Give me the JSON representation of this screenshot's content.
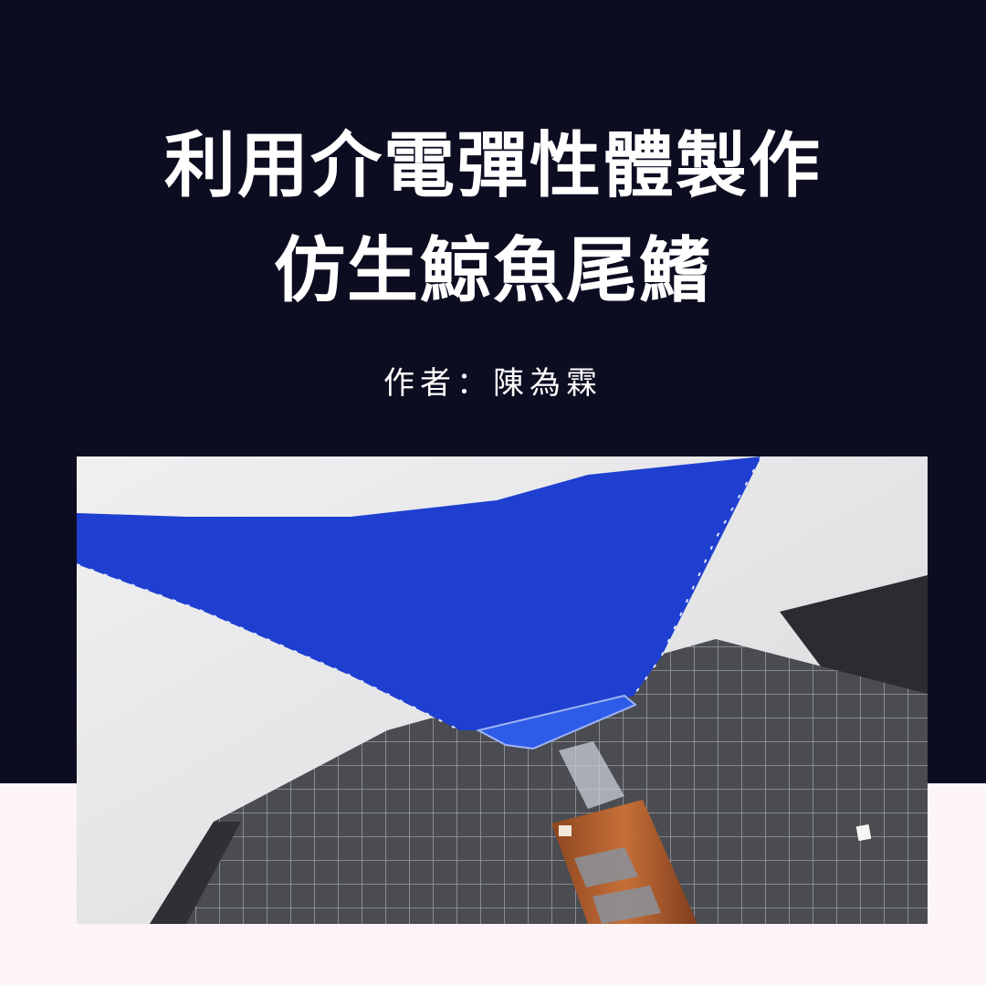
{
  "poster": {
    "title_line1": "利用介電彈性體製作",
    "title_line2": "仿生鯨魚尾鰭",
    "author": "作者：陳為霖"
  },
  "colors": {
    "top_background": "#0d0d22",
    "bottom_background": "#fdf4fa",
    "title_text": "#ffffff",
    "fin_blue": "#1e3fd0",
    "cutting_mat": "#4a4c52",
    "copper_tape": "#b8612e"
  },
  "photo": {
    "subject": "blue whale tail fin prototype on grid cutting mat"
  }
}
